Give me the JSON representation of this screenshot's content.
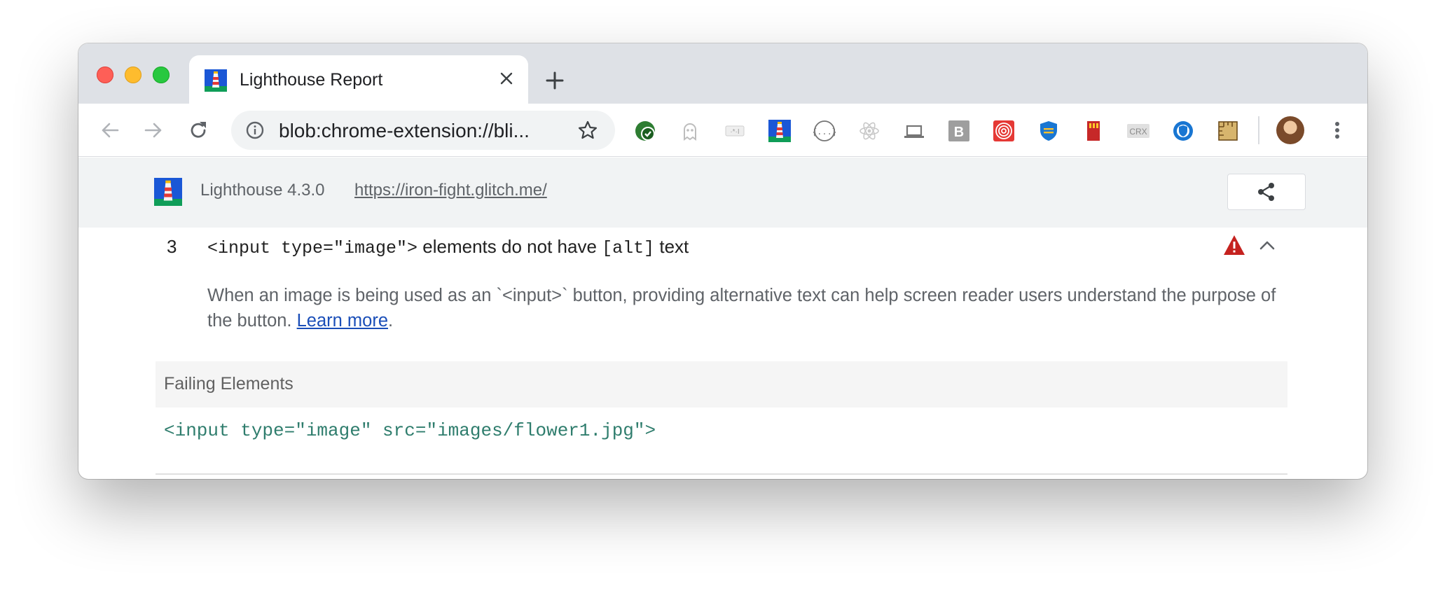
{
  "tab": {
    "title": "Lighthouse Report"
  },
  "omnibox": {
    "url": "blob:chrome-extension://bli..."
  },
  "extensions": [
    {
      "name": "grammarly-check-icon",
      "color": "#2e7d32"
    },
    {
      "name": "ghostery-icon",
      "color": "#bdbdbd"
    },
    {
      "name": "star-ext-icon",
      "color": "#bdbdbd"
    },
    {
      "name": "lighthouse-ext-icon",
      "color": "#1a57d6"
    },
    {
      "name": "json-viewer-icon",
      "color": "#757575"
    },
    {
      "name": "react-devtools-icon",
      "color": "#c0c0c0"
    },
    {
      "name": "laptop-icon",
      "color": "#757575"
    },
    {
      "name": "bold-b-icon",
      "color": "#9e9e9e"
    },
    {
      "name": "target-spiral-icon",
      "color": "#e53935"
    },
    {
      "name": "shield-ext-icon",
      "color": "#1976d2"
    },
    {
      "name": "sd-card-icon",
      "color": "#c62828"
    },
    {
      "name": "crx-icon",
      "color": "#9e9e9e"
    },
    {
      "name": "privacy-badger-icon",
      "color": "#1976d2"
    },
    {
      "name": "tape-measure-icon",
      "color": "#c19a50"
    }
  ],
  "extensions_crx_label": "CRX",
  "extensions_b_label": "B",
  "lighthouse": {
    "version": "Lighthouse 4.3.0",
    "url": "https://iron-fight.glitch.me/"
  },
  "audit": {
    "number": "3",
    "title_code": "<input type=\"image\">",
    "title_mid": " elements do not have ",
    "title_code2": "[alt]",
    "title_end": " text",
    "description": "When an image is being used as an `<input>` button, providing alternative text can help screen reader users understand the purpose of the button. ",
    "learn_more": "Learn more",
    "period": ".",
    "failing_header": "Failing Elements",
    "failing_element": "<input type=\"image\" src=\"images/flower1.jpg\">"
  },
  "colors": {
    "warning": "#c5221f",
    "link": "#1a4eb8",
    "code": "#2f7d6d"
  }
}
